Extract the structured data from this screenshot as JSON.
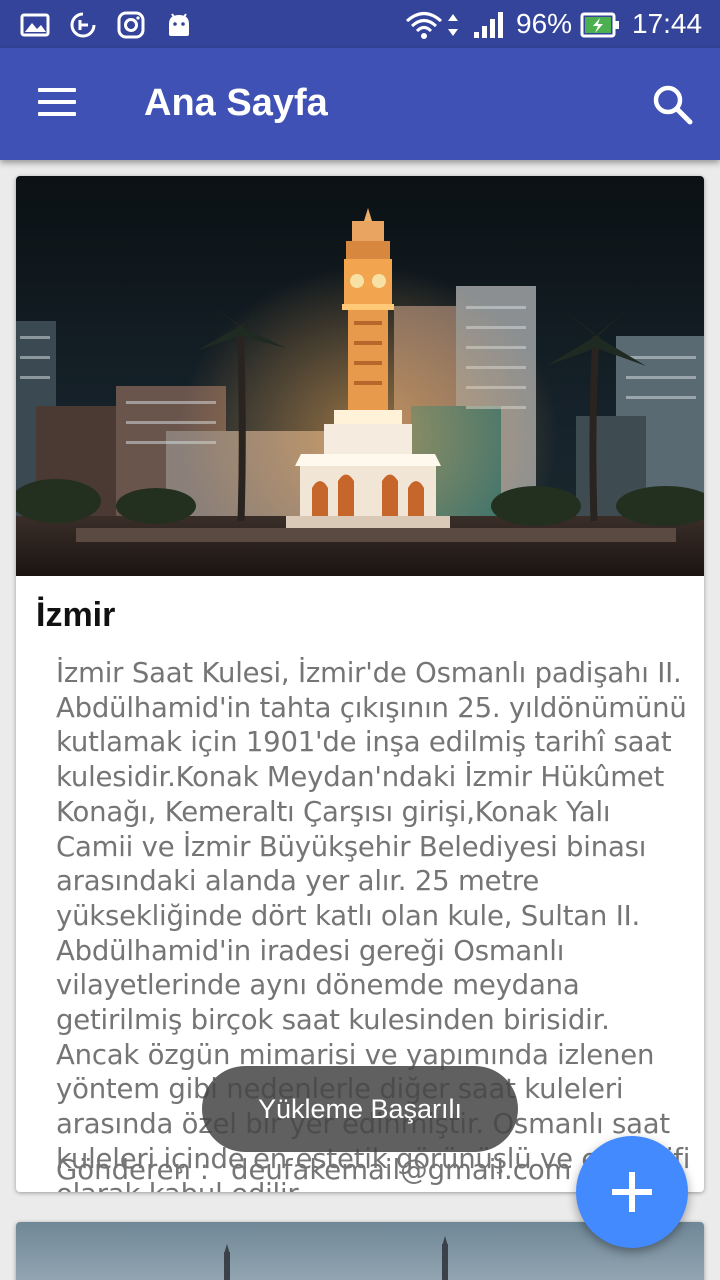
{
  "status_bar": {
    "battery_percent": "96%",
    "time": "17:44",
    "icons": [
      "gallery-icon",
      "sync-icon",
      "instagram-icon",
      "android-icon",
      "wifi-icon",
      "signal-icon",
      "battery-charging-icon"
    ]
  },
  "app_bar": {
    "title": "Ana Sayfa",
    "menu_icon": "hamburger-menu-icon",
    "search_icon": "search-icon"
  },
  "post": {
    "title": "İzmir",
    "body": "İzmir Saat Kulesi, İzmir'de Osmanlı padişahı II. Abdülhamid'in tahta çıkışının 25. yıldönümünü kutlamak için 1901'de inşa edilmiş tarihî saat kulesidir.Konak Meydan'ndaki İzmir Hükûmet Konağı, Kemeraltı Çarşısı girişi,Konak Yalı Camii ve İzmir Büyükşehir Belediyesi binası arasındaki alanda yer alır. 25 metre yüksekliğinde dört katlı olan kule, Sultan II. Abdülhamid'in iradesi gereği Osmanlı vilayetlerinde aynı dönemde meydana getirilmiş birçok saat kulesinden birisidir. Ancak özgün mimarisi ve yapımında izlenen yöntem gibi nedenlerle diğer saat kuleleri arasında özel bir yer edinmiştir. Osmanlı saat kuleleri içinde en estetik görünüşlü ve en zarifi olarak kabul edilir.",
    "sender_label": "Gönderen :",
    "sender_email": "deufakemail@gmail.com"
  },
  "toast": {
    "message": "Yükleme  Başarılı"
  },
  "fab": {
    "icon": "add-icon"
  },
  "colors": {
    "status_bar": "#34449a",
    "app_bar": "#3f51b5",
    "fab": "#448aff",
    "background": "#ebebeb"
  }
}
